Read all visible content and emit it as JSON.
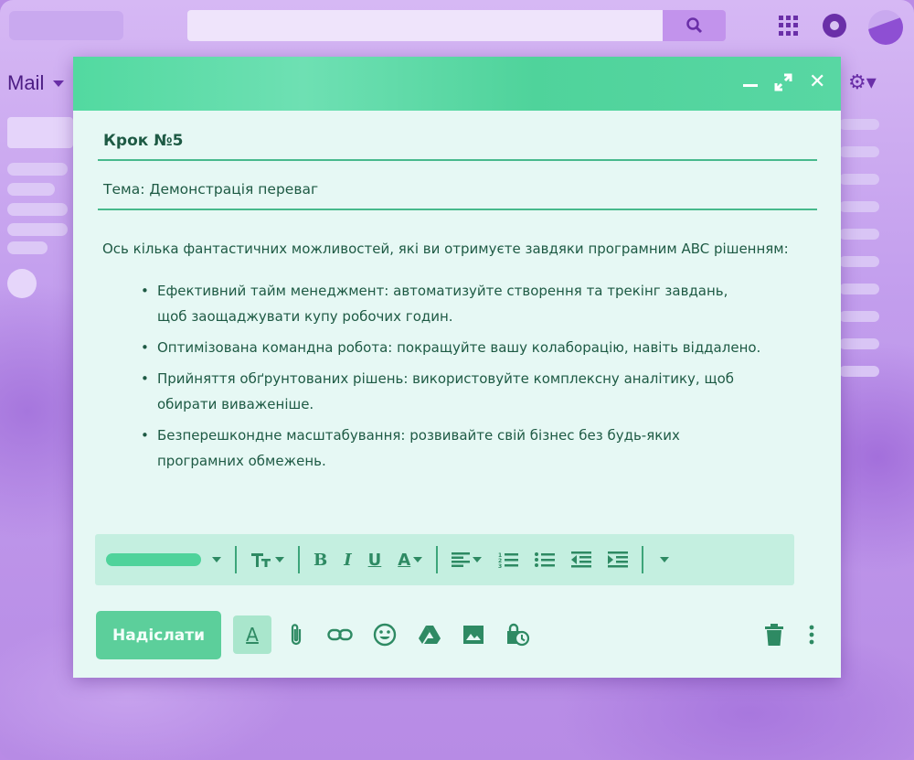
{
  "app": {
    "mail_label": "Mail"
  },
  "compose": {
    "to": "Крок №5",
    "subject": "Тема: Демонстрація переваг",
    "intro": "Ось кілька фантастичних можливостей, які ви отримуєте завдяки програмним ABC рішенням:",
    "bullets": [
      {
        "line1": "Ефективний тайм менеджмент: автоматизуйте створення та трекінг завдань,",
        "line2": "щоб заощаджувати купу робочих годин."
      },
      {
        "line1": "Оптимізована командна робота: покращуйте вашу колаборацію, навіть віддалено.",
        "line2": ""
      },
      {
        "line1": "Прийняття обґрунтованих рішень: використовуйте комплексну аналітику, щоб",
        "line2": "обирати виваженіше."
      },
      {
        "line1": "Безперешкондне масштабування: розвивайте свій бізнес без будь-яких",
        "line2": "програмних обмежень."
      }
    ],
    "send_label": "Надіслати",
    "header_buttons": {
      "minimize": "–",
      "maximize": "⤢",
      "close": "✕"
    }
  },
  "toolbar": {
    "bold": "B",
    "italic": "I",
    "underline": "U",
    "text_color": "A",
    "format_button": "A"
  },
  "colors": {
    "header_green": "#52d9a0",
    "text_green": "#1e5a44",
    "background_purple": "#b98be6"
  },
  "icons": [
    "search-icon",
    "apps-icon",
    "notifications-icon",
    "settings-icon",
    "minimize-icon",
    "maximize-icon",
    "close-icon",
    "attach-icon",
    "link-icon",
    "emoji-icon",
    "drive-icon",
    "image-icon",
    "confidential-icon",
    "trash-icon",
    "more-icon"
  ]
}
